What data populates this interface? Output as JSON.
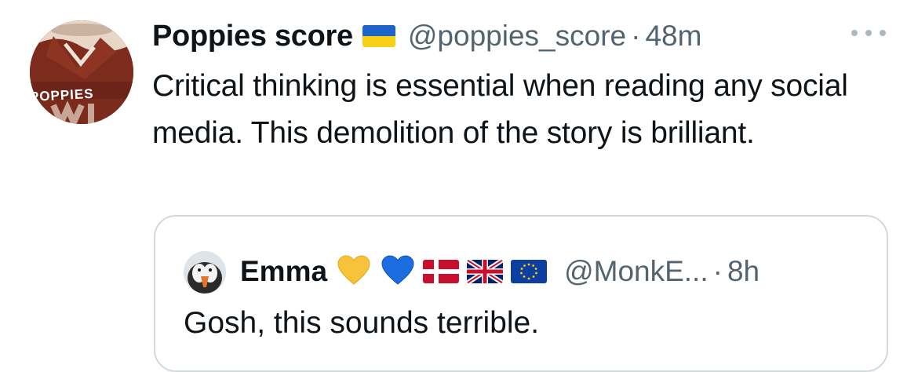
{
  "tweet": {
    "display_name": "Poppies score",
    "flag_icon": "ukraine-flag",
    "handle": "@poppies_score",
    "separator": "·",
    "time": "48m",
    "more_icon": "more-options-icon",
    "text": "Critical thinking is essential when reading any social media. This demolition of the story is brilliant.",
    "avatar_text": "POPPIES",
    "avatar_text_2": "WI"
  },
  "quote": {
    "display_name": "Emma",
    "emojis": [
      "yellow-heart",
      "blue-heart",
      "denmark-flag",
      "uk-flag",
      "eu-flag"
    ],
    "handle": "@MonkE...",
    "separator": "·",
    "time": "8h",
    "text": "Gosh, this sounds terrible."
  },
  "colors": {
    "primary_text": "#0f1419",
    "secondary_text": "#536471",
    "border": "#cfd9de",
    "ua_blue": "#1d63c9",
    "ua_yellow": "#f7d117"
  }
}
